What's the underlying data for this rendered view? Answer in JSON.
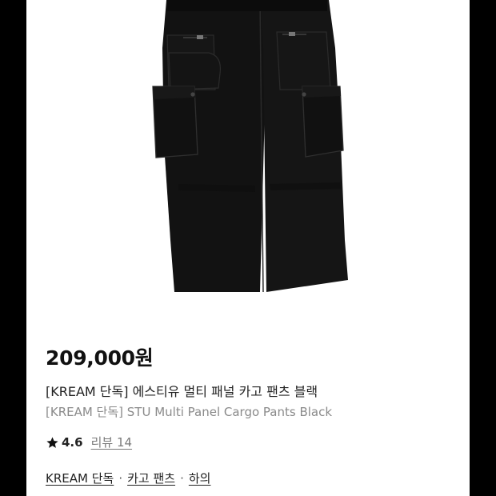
{
  "product": {
    "price": "209,000원",
    "title_ko": "[KREAM 단독] 에스티유 멀티 패널 카고 팬츠 블랙",
    "title_en": "[KREAM 단독] STU Multi Panel Cargo Pants Black",
    "rating": "4.6",
    "review_label": "리뷰 14",
    "image_icon": "black-cargo-pants-image"
  },
  "categories": {
    "items": [
      "KREAM 단독",
      "카고 팬츠",
      "하의"
    ],
    "separator": "·"
  },
  "colors": {
    "background": "#000000",
    "card": "#ffffff",
    "pants": "#111111",
    "text_primary": "#222222",
    "text_secondary": "#8a8a8a"
  }
}
